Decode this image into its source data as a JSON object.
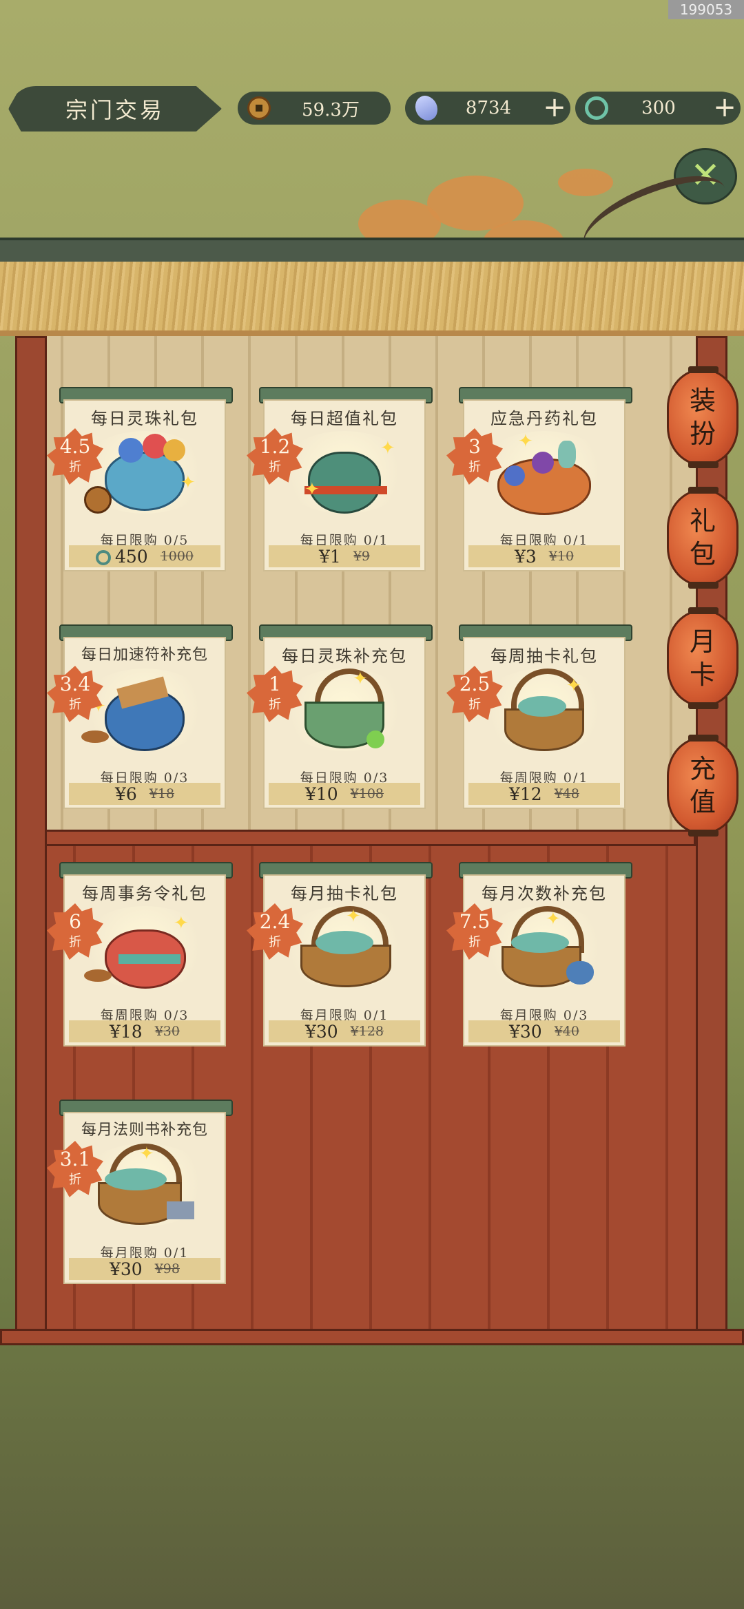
{
  "watermark": "199053",
  "header": {
    "title": "宗门交易",
    "copper": "59.3万",
    "jade": "8734",
    "spirit": "300",
    "plus": "+"
  },
  "close_label": "✕",
  "side_tabs": [
    {
      "line1": "装",
      "line2": "扮"
    },
    {
      "line1": "礼",
      "line2": "包"
    },
    {
      "line1": "月",
      "line2": "卡"
    },
    {
      "line1": "充",
      "line2": "值"
    }
  ],
  "zhe_label": "折",
  "cards": [
    {
      "name": "每日灵珠礼包",
      "discount": "4.5",
      "limit": "每日限购 0/5",
      "price": "450",
      "original": "1000",
      "currency_icon": "spirit-coin-icon"
    },
    {
      "name": "每日超值礼包",
      "discount": "1.2",
      "limit": "每日限购 0/1",
      "price": "¥1",
      "original": "¥9"
    },
    {
      "name": "应急丹药礼包",
      "discount": "3",
      "limit": "每日限购 0/1",
      "price": "¥3",
      "original": "¥10"
    },
    {
      "name": "每日加速符补充包",
      "discount": "3.4",
      "limit": "每日限购 0/3",
      "price": "¥6",
      "original": "¥18"
    },
    {
      "name": "每日灵珠补充包",
      "discount": "1",
      "limit": "每日限购 0/3",
      "price": "¥10",
      "original": "¥108"
    },
    {
      "name": "每周抽卡礼包",
      "discount": "2.5",
      "limit": "每周限购 0/1",
      "price": "¥12",
      "original": "¥48"
    },
    {
      "name": "每周事务令礼包",
      "discount": "6",
      "limit": "每周限购 0/3",
      "price": "¥18",
      "original": "¥30"
    },
    {
      "name": "每月抽卡礼包",
      "discount": "2.4",
      "limit": "每月限购 0/1",
      "price": "¥30",
      "original": "¥128"
    },
    {
      "name": "每月次数补充包",
      "discount": "7.5",
      "limit": "每月限购 0/3",
      "price": "¥30",
      "original": "¥40"
    },
    {
      "name": "每月法则书补充包",
      "discount": "3.1",
      "limit": "每月限购 0/1",
      "price": "¥30",
      "original": "¥98"
    }
  ]
}
